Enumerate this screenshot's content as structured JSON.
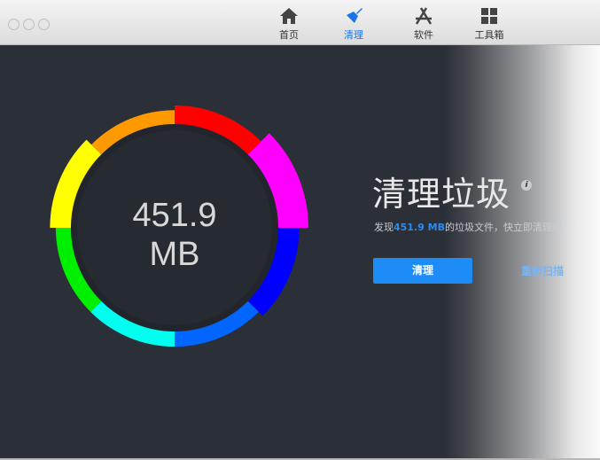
{
  "window_controls": [
    "close",
    "minimize",
    "zoom"
  ],
  "toolbar": {
    "tabs": [
      {
        "label": "首页",
        "icon": "home-icon",
        "active": false
      },
      {
        "label": "清理",
        "icon": "broom-icon",
        "active": true
      },
      {
        "label": "软件",
        "icon": "app-store-icon",
        "active": false
      },
      {
        "label": "工具箱",
        "icon": "grid-icon",
        "active": false
      }
    ]
  },
  "gauge": {
    "value": "451.9",
    "unit": "MB",
    "segments": [
      {
        "color": "#ff0000",
        "level": 0.5
      },
      {
        "color": "#ff00ff",
        "level": 1.0
      },
      {
        "color": "#0000ff",
        "level": 0.6
      },
      {
        "color": "#0066ff",
        "level": 0.35
      },
      {
        "color": "#00ffee",
        "level": 0.35
      },
      {
        "color": "#00ee00",
        "level": 0.35
      },
      {
        "color": "#ffff00",
        "level": 0.6
      },
      {
        "color": "#ff9900",
        "level": 0.3
      }
    ]
  },
  "main": {
    "title": "清理垃圾",
    "info_icon": "i",
    "desc_prefix": "发现",
    "desc_size": "451.9 MB",
    "desc_suffix": "的垃圾文件，快立即清理吧",
    "clean_button": "清理",
    "rescan_link": "重新扫描"
  },
  "colors": {
    "accent": "#1e8cf6",
    "background": "#2b2f37"
  }
}
